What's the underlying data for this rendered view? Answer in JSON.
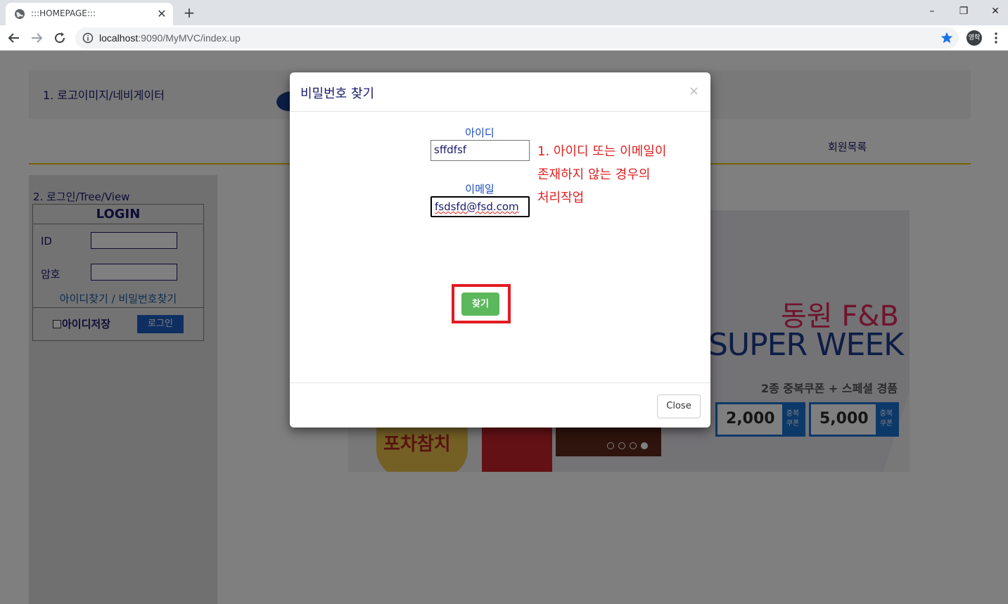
{
  "browser": {
    "tab_title": ":::HOMEPAGE:::",
    "tab_close": "✕",
    "new_tab": "+",
    "url_host": "localhost",
    "url_rest": ":9090/MyMVC/index.up",
    "avatar_text": "영학",
    "window_controls": {
      "minimize": "–",
      "restore": "❐",
      "close": "✕"
    },
    "icons": [
      "globe-icon",
      "back-icon",
      "forward-icon",
      "reload-icon",
      "info-icon",
      "star-icon",
      "menu-icon"
    ],
    "accent_color": "#1a73e8"
  },
  "page": {
    "header_label": "1. 로고이미지/네비게이터",
    "nav_members": "회원목록",
    "sidebar_title": "2. 로그인/Tree/View",
    "login": {
      "heading": "LOGIN",
      "id_label": "ID",
      "pw_label": "암호",
      "find_id": "아이디찾기",
      "separator": "/",
      "find_pw": "비밀번호찾기",
      "save_id": "아이디저장",
      "login_button": "로그인"
    },
    "banner": {
      "brand": "동원 F&B",
      "title": "SUPER WEEK",
      "subtitle": "2종 중복쿠폰 + 스페셜 경품",
      "coupons": [
        {
          "value": "2,000",
          "tag": "중복 쿠폰"
        },
        {
          "value": "5,000",
          "tag": "중복 쿠폰"
        }
      ],
      "product_label": "포차참치",
      "slide_count": 4,
      "active_slide": 4
    }
  },
  "modal": {
    "title": "비밀번호 찾기",
    "close_x": "×",
    "id_label": "아이디",
    "id_value": "sffdfsf",
    "email_label": "이메일",
    "email_value": "fsdsfd@fsd.com",
    "note_lines": [
      "1. 아이디 또는 이메일이",
      "존재하지 않는 경우의",
      "처리작업"
    ],
    "find_button": "찾기",
    "close_button": "Close",
    "highlight_color": "#e31b23",
    "find_button_color": "#5cb85c"
  }
}
